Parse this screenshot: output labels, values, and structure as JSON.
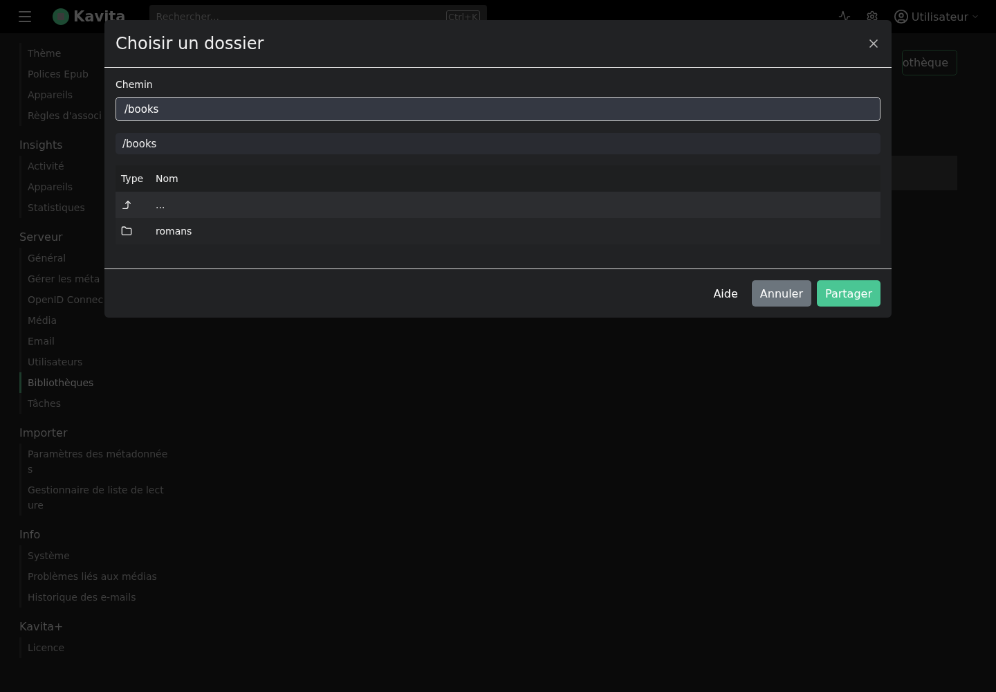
{
  "header": {
    "brand": "Kavita",
    "search": {
      "placeholder": "Rechercher...",
      "shortcut": "Ctrl+K"
    },
    "user": "Utilisateur"
  },
  "sidebar": {
    "sections": [
      {
        "items": [
          {
            "label": "Thème",
            "selected": false
          },
          {
            "label": "Polices Epub",
            "selected": false
          },
          {
            "label": "Appareils",
            "selected": false
          },
          {
            "label": "Règles d'associ",
            "selected": false
          }
        ]
      },
      {
        "title": "Insights",
        "items": [
          {
            "label": "Activité",
            "selected": false
          },
          {
            "label": "Appareils",
            "selected": false
          },
          {
            "label": "Statistiques",
            "selected": false
          }
        ]
      },
      {
        "title": "Serveur",
        "items": [
          {
            "label": "Général",
            "selected": false
          },
          {
            "label": "Gérer les méta",
            "selected": false
          },
          {
            "label": "OpenID Connec",
            "selected": false
          },
          {
            "label": "Média",
            "selected": false
          },
          {
            "label": "Email",
            "selected": false
          },
          {
            "label": "Utilisateurs",
            "selected": false
          },
          {
            "label": "Bibliothèques",
            "selected": true
          },
          {
            "label": "Tâches",
            "selected": false
          }
        ]
      },
      {
        "title": "Importer",
        "items": [
          {
            "label": "Paramètres des métadonnées",
            "selected": false
          },
          {
            "label": "Gestionnaire de liste de lecture",
            "selected": false
          }
        ]
      },
      {
        "title": "Info",
        "items": [
          {
            "label": "Système",
            "selected": false
          },
          {
            "label": "Problèmes liés aux médias",
            "selected": false
          },
          {
            "label": "Historique des e-mails",
            "selected": false
          }
        ]
      },
      {
        "title": "Kavita+",
        "items": [
          {
            "label": "Licence",
            "selected": false
          }
        ]
      }
    ]
  },
  "main": {
    "button": "othèque"
  },
  "dialog": {
    "title": "Choisir un dossier",
    "path_label": "Chemin",
    "path_value": "/books",
    "breadcrumb": "/books",
    "table": {
      "columns": [
        "Type",
        "Nom"
      ],
      "rows": [
        {
          "kind": "parent",
          "name": "..."
        },
        {
          "kind": "folder",
          "name": "romans"
        }
      ]
    },
    "buttons": [
      {
        "label": "Aide",
        "kind": "link"
      },
      {
        "label": "Annuler",
        "kind": "secondary"
      },
      {
        "label": "Partager",
        "kind": "primary"
      }
    ]
  }
}
